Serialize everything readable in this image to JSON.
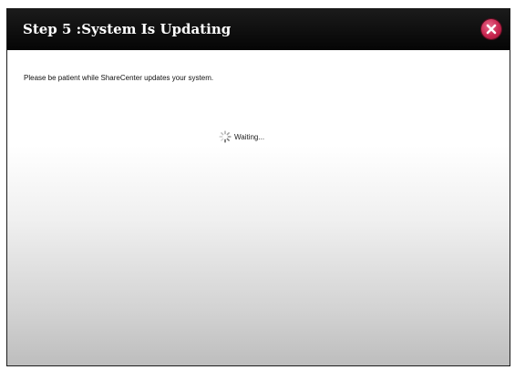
{
  "dialog": {
    "title": "Step 5 :System Is Updating",
    "close_icon": "close-icon",
    "message": "Please be patient while ShareCenter updates your system.",
    "status": {
      "icon": "spinner-icon",
      "text": "Waiting..."
    }
  },
  "colors": {
    "title_bar": "#0d0d0d",
    "title_text": "#ffffff",
    "close_button": "#c8254f",
    "body_top": "#ffffff",
    "body_bottom": "#bdbdbd"
  }
}
